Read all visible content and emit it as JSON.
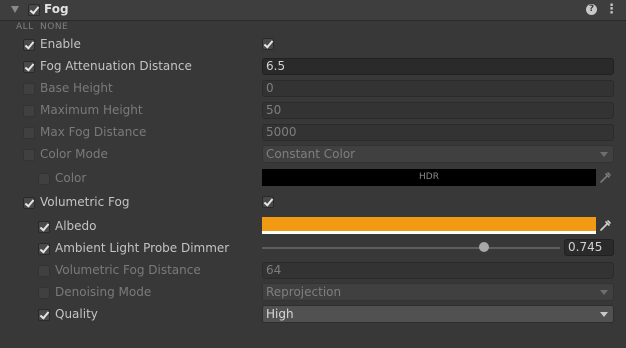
{
  "component": {
    "title": "Fog",
    "all_label": "ALL",
    "none_label": "NONE"
  },
  "rows": {
    "enable": {
      "label": "Enable",
      "value_checked": true
    },
    "fog_attenuation_distance": {
      "label": "Fog Attenuation Distance",
      "value": "6.5"
    },
    "base_height": {
      "label": "Base Height",
      "value": "0"
    },
    "maximum_height": {
      "label": "Maximum Height",
      "value": "50"
    },
    "max_fog_distance": {
      "label": "Max Fog Distance",
      "value": "5000"
    },
    "color_mode": {
      "label": "Color Mode",
      "value": "Constant Color"
    },
    "color": {
      "label": "Color",
      "badge": "HDR",
      "swatch": "#000000"
    },
    "volumetric_fog": {
      "label": "Volumetric Fog",
      "value_checked": true
    },
    "albedo": {
      "label": "Albedo",
      "swatch": "#f39a14"
    },
    "ambient_light_probe_dimmer": {
      "label": "Ambient Light Probe Dimmer",
      "value": "0.745",
      "slider_fraction": 0.745
    },
    "volumetric_fog_distance": {
      "label": "Volumetric Fog Distance",
      "value": "64"
    },
    "denoising_mode": {
      "label": "Denoising Mode",
      "value": "Reprojection"
    },
    "quality": {
      "label": "Quality",
      "value": "High"
    }
  },
  "icons": {
    "help": "help-icon",
    "menu": "kebab-menu-icon",
    "picker": "eyedropper-icon",
    "foldout": "foldout-arrow-icon"
  }
}
